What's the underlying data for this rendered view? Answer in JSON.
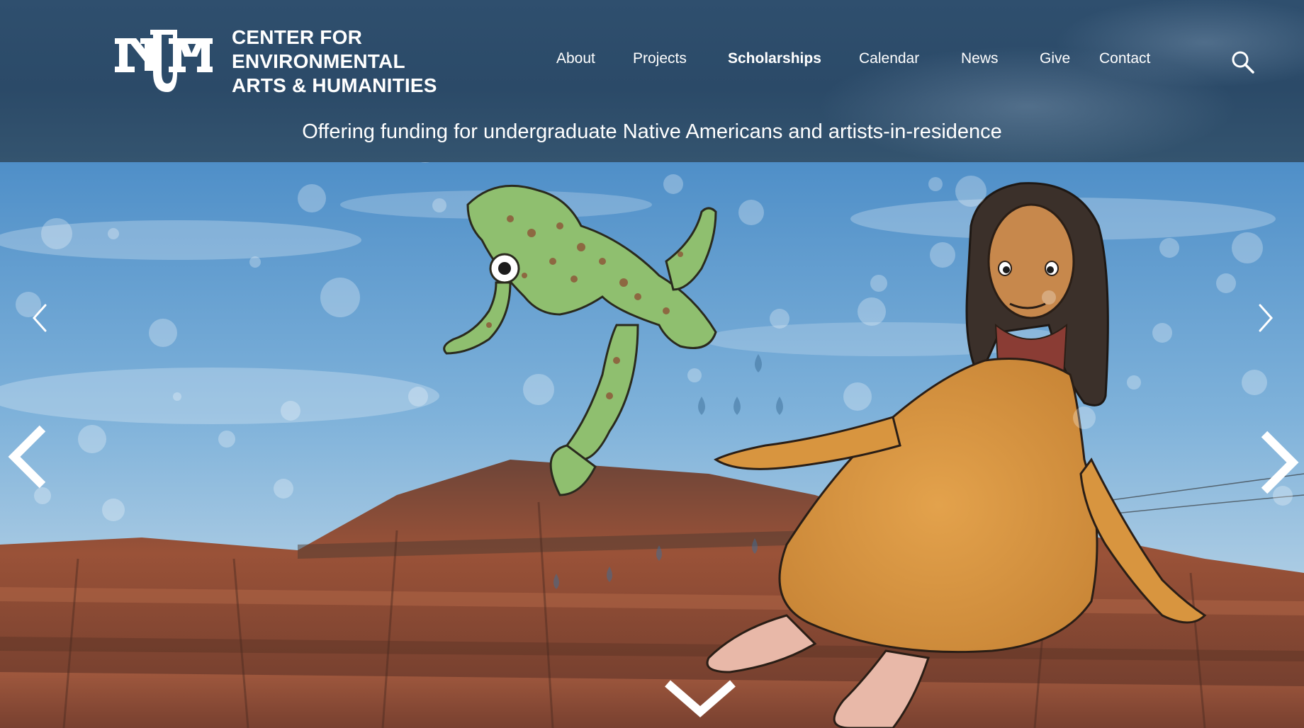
{
  "site": {
    "logo_alt": "UNM",
    "brand_lines": [
      "CENTER FOR",
      "ENVIRONMENTAL",
      "ARTS & HUMANITIES"
    ]
  },
  "nav": {
    "items": [
      {
        "label": "About",
        "active": false
      },
      {
        "label": "Projects",
        "active": false
      },
      {
        "label": "Scholarships",
        "active": true
      },
      {
        "label": "Calendar",
        "active": false
      },
      {
        "label": "News",
        "active": false
      },
      {
        "label": "Give",
        "active": false
      },
      {
        "label": "Contact",
        "active": false
      }
    ],
    "search_icon": "search-icon"
  },
  "hero": {
    "tagline": "Offering funding for undergraduate Native Americans and artists-in-residence",
    "icons": {
      "prev_small": "chevron-left-icon",
      "next_small": "chevron-right-icon",
      "prev_large": "chevron-left-icon",
      "next_large": "chevron-right-icon",
      "scroll_down": "chevron-down-icon"
    }
  },
  "colors": {
    "header_bg": "#2d4c6a",
    "sky": "#5f9ccf",
    "mesa": "#8a4a34",
    "frog": "#8cc070",
    "dress": "#d8953f"
  }
}
